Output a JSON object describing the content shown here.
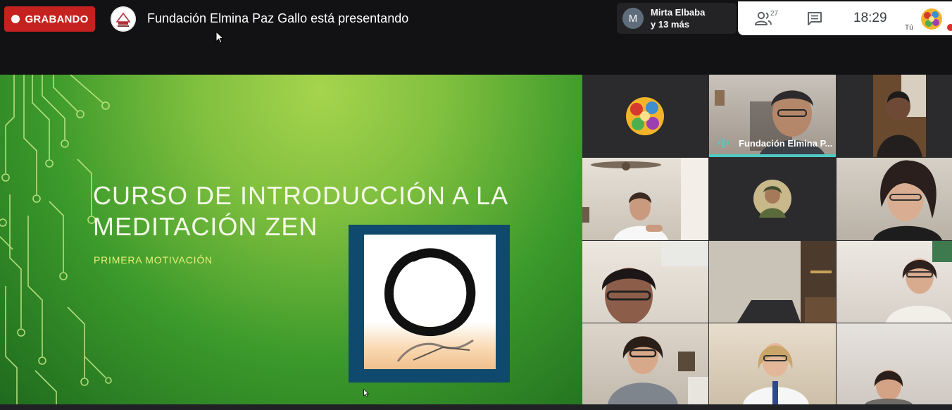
{
  "topbar": {
    "recording_label": "GRABANDO",
    "presenting_text": "Fundación Elmina Paz Gallo está presentando"
  },
  "participants_chip": {
    "avatar_letter": "M",
    "line1": "Mirta Elbaba",
    "line2": "y 13 más"
  },
  "controls": {
    "people_count": "27",
    "clock": "18:29",
    "self_label": "Tú"
  },
  "slide": {
    "title_line1": "CURSO DE INTRODUCCIÓN A LA",
    "title_line2": "MEDITACIÓN ZEN",
    "subtitle": "PRIMERA MOTIVACIÓN"
  },
  "tiles": {
    "speaker_name": "Fundación Elmina P..."
  },
  "colors": {
    "recording": "#c5221f",
    "speaking_indicator": "#50c9c3",
    "slide_green": "#7fbf3e",
    "frame_blue": "#0f4a6e"
  },
  "icons": [
    "record-dot-icon",
    "people-icon",
    "chat-icon",
    "audio-wave-icon",
    "cursor-icon"
  ]
}
